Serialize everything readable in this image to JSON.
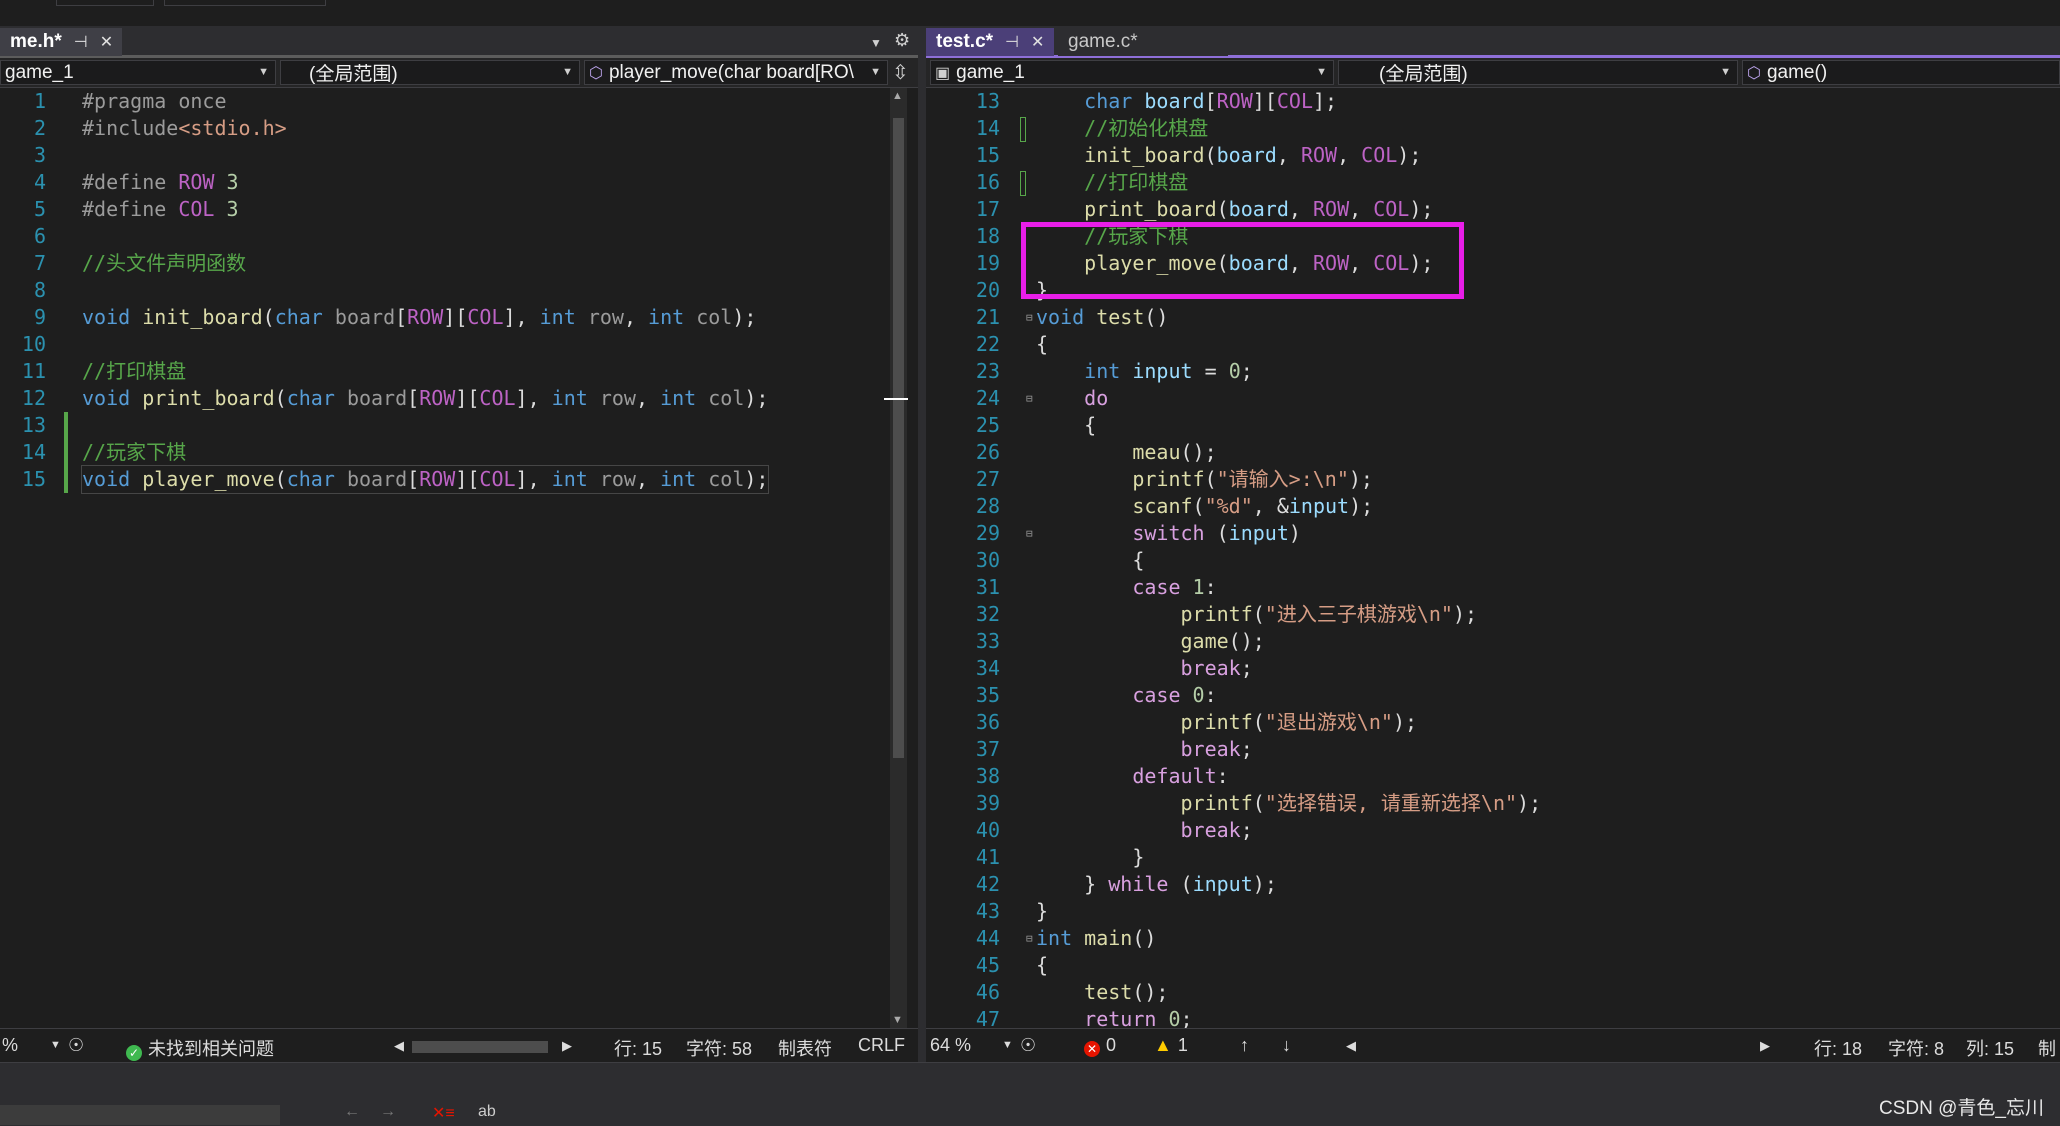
{
  "colors": {
    "highlight_box": "#e81ee8",
    "accent_tab": "#8e6fd8"
  },
  "left": {
    "tab_title": "me.h*",
    "tab_pin": "⊣",
    "tab_close": "✕",
    "nav": {
      "project": "game_1",
      "scope": "(全局范围)",
      "member": "player_move(char board[RO\\"
    },
    "status": {
      "zoom": "%",
      "issues": "未找到相关问题",
      "line": "行: 15",
      "char": "字符: 58",
      "tabs": "制表符",
      "eol": "CRLF"
    }
  },
  "right": {
    "tabs": [
      {
        "label": "test.c*",
        "pin": "⊣",
        "close": "✕"
      },
      {
        "label": "game.c*"
      }
    ],
    "nav": {
      "project": "game_1",
      "scope": "(全局范围)",
      "member": "game()"
    },
    "status": {
      "zoom": "64 %",
      "errors": "0",
      "warnings": "1",
      "line": "行: 18",
      "char": "字符: 8",
      "col": "列: 15",
      "tabs": "制"
    }
  },
  "left_code": [
    {
      "n": "1",
      "t": [
        [
          "pp",
          "#pragma once"
        ]
      ]
    },
    {
      "n": "2",
      "t": [
        [
          "pp",
          "#include"
        ],
        [
          "str",
          "<stdio.h>"
        ]
      ]
    },
    {
      "n": "3",
      "t": []
    },
    {
      "n": "4",
      "t": [
        [
          "pp",
          "#define "
        ],
        [
          "mac",
          "ROW"
        ],
        [
          "num",
          " 3"
        ]
      ]
    },
    {
      "n": "5",
      "t": [
        [
          "pp",
          "#define "
        ],
        [
          "mac",
          "COL"
        ],
        [
          "num",
          " 3"
        ]
      ]
    },
    {
      "n": "6",
      "t": []
    },
    {
      "n": "7",
      "t": [
        [
          "cm",
          "//头文件声明函数"
        ]
      ]
    },
    {
      "n": "8",
      "t": []
    },
    {
      "n": "9",
      "t": [
        [
          "kw",
          "void "
        ],
        [
          "fn",
          "init_board"
        ],
        [
          "",
          "("
        ],
        [
          "kw",
          "char "
        ],
        [
          "pp",
          "board"
        ],
        [
          "",
          "["
        ],
        [
          "mac",
          "ROW"
        ],
        [
          "",
          "]["
        ],
        [
          "mac",
          "COL"
        ],
        [
          "",
          "], "
        ],
        [
          "kw",
          "int "
        ],
        [
          "pp",
          "row"
        ],
        [
          "",
          ", "
        ],
        [
          "kw",
          "int "
        ],
        [
          "pp",
          "col"
        ],
        [
          "",
          ");"
        ]
      ]
    },
    {
      "n": "10",
      "t": []
    },
    {
      "n": "11",
      "t": [
        [
          "cm",
          "//打印棋盘"
        ]
      ]
    },
    {
      "n": "12",
      "t": [
        [
          "kw",
          "void "
        ],
        [
          "fn",
          "print_board"
        ],
        [
          "",
          "("
        ],
        [
          "kw",
          "char "
        ],
        [
          "pp",
          "board"
        ],
        [
          "",
          "["
        ],
        [
          "mac",
          "ROW"
        ],
        [
          "",
          "]["
        ],
        [
          "mac",
          "COL"
        ],
        [
          "",
          "], "
        ],
        [
          "kw",
          "int "
        ],
        [
          "pp",
          "row"
        ],
        [
          "",
          ", "
        ],
        [
          "kw",
          "int "
        ],
        [
          "pp",
          "col"
        ],
        [
          "",
          ");"
        ]
      ]
    },
    {
      "n": "13",
      "t": []
    },
    {
      "n": "14",
      "t": [
        [
          "cm",
          "//玩家下棋"
        ]
      ]
    },
    {
      "n": "15",
      "t": [
        [
          "kw",
          "void "
        ],
        [
          "fn",
          "player_move"
        ],
        [
          "",
          "("
        ],
        [
          "kw",
          "char "
        ],
        [
          "pp",
          "board"
        ],
        [
          "",
          "["
        ],
        [
          "mac",
          "ROW"
        ],
        [
          "",
          "]["
        ],
        [
          "mac",
          "COL"
        ],
        [
          "",
          "], "
        ],
        [
          "kw",
          "int "
        ],
        [
          "pp",
          "row"
        ],
        [
          "",
          ", "
        ],
        [
          "kw",
          "int "
        ],
        [
          "pp",
          "col"
        ],
        [
          "",
          ");"
        ]
      ]
    }
  ],
  "right_code": [
    {
      "n": "13",
      "t": [
        [
          "",
          "    "
        ],
        [
          "kw",
          "char "
        ],
        [
          "var",
          "board"
        ],
        [
          "",
          "["
        ],
        [
          "mac",
          "ROW"
        ],
        [
          "",
          "]["
        ],
        [
          "mac",
          "COL"
        ],
        [
          "",
          "];"
        ]
      ]
    },
    {
      "n": "14",
      "t": [
        [
          "",
          "    "
        ],
        [
          "cm",
          "//初始化棋盘"
        ]
      ]
    },
    {
      "n": "15",
      "t": [
        [
          "",
          "    "
        ],
        [
          "fn",
          "init_board"
        ],
        [
          "",
          "("
        ],
        [
          "var",
          "board"
        ],
        [
          "",
          ", "
        ],
        [
          "mac",
          "ROW"
        ],
        [
          "",
          ", "
        ],
        [
          "mac",
          "COL"
        ],
        [
          "",
          ");"
        ]
      ]
    },
    {
      "n": "16",
      "t": [
        [
          "",
          "    "
        ],
        [
          "cm",
          "//打印棋盘"
        ]
      ]
    },
    {
      "n": "17",
      "t": [
        [
          "",
          "    "
        ],
        [
          "fn",
          "print_board"
        ],
        [
          "",
          "("
        ],
        [
          "var",
          "board"
        ],
        [
          "",
          ", "
        ],
        [
          "mac",
          "ROW"
        ],
        [
          "",
          ", "
        ],
        [
          "mac",
          "COL"
        ],
        [
          "",
          ");"
        ]
      ]
    },
    {
      "n": "18",
      "t": [
        [
          "",
          "    "
        ],
        [
          "cm",
          "//玩家下棋"
        ]
      ]
    },
    {
      "n": "19",
      "t": [
        [
          "",
          "    "
        ],
        [
          "fn",
          "player_move"
        ],
        [
          "",
          "("
        ],
        [
          "var",
          "board"
        ],
        [
          "",
          ", "
        ],
        [
          "mac",
          "ROW"
        ],
        [
          "",
          ", "
        ],
        [
          "mac",
          "COL"
        ],
        [
          "",
          ");"
        ]
      ]
    },
    {
      "n": "20",
      "t": [
        [
          "",
          "}"
        ]
      ]
    },
    {
      "n": "21",
      "t": [
        [
          "kw",
          "void "
        ],
        [
          "fn",
          "test"
        ],
        [
          "",
          "()"
        ]
      ]
    },
    {
      "n": "22",
      "t": [
        [
          "",
          "{"
        ]
      ]
    },
    {
      "n": "23",
      "t": [
        [
          "",
          "    "
        ],
        [
          "kw",
          "int "
        ],
        [
          "var",
          "input"
        ],
        [
          "",
          " = "
        ],
        [
          "num",
          "0"
        ],
        [
          "",
          ";"
        ]
      ]
    },
    {
      "n": "24",
      "t": [
        [
          "",
          "    "
        ],
        [
          "kw2",
          "do"
        ]
      ]
    },
    {
      "n": "25",
      "t": [
        [
          "",
          "    {"
        ]
      ]
    },
    {
      "n": "26",
      "t": [
        [
          "",
          "        "
        ],
        [
          "fn",
          "meau"
        ],
        [
          "",
          "();"
        ]
      ]
    },
    {
      "n": "27",
      "t": [
        [
          "",
          "        "
        ],
        [
          "fn",
          "printf"
        ],
        [
          "",
          "("
        ],
        [
          "str",
          "\"请输入>:\\n\""
        ],
        [
          "",
          ");"
        ]
      ]
    },
    {
      "n": "28",
      "t": [
        [
          "",
          "        "
        ],
        [
          "fn",
          "scanf"
        ],
        [
          "",
          "("
        ],
        [
          "str",
          "\"%d\""
        ],
        [
          "",
          ", &"
        ],
        [
          "var",
          "input"
        ],
        [
          "",
          ");"
        ]
      ]
    },
    {
      "n": "29",
      "t": [
        [
          "",
          "        "
        ],
        [
          "kw2",
          "switch"
        ],
        [
          "",
          " ("
        ],
        [
          "var",
          "input"
        ],
        [
          "",
          ")"
        ]
      ]
    },
    {
      "n": "30",
      "t": [
        [
          "",
          "        {"
        ]
      ]
    },
    {
      "n": "31",
      "t": [
        [
          "",
          "        "
        ],
        [
          "kw2",
          "case "
        ],
        [
          "num",
          "1"
        ],
        [
          "",
          ":"
        ]
      ]
    },
    {
      "n": "32",
      "t": [
        [
          "",
          "            "
        ],
        [
          "fn",
          "printf"
        ],
        [
          "",
          "("
        ],
        [
          "str",
          "\"进入三子棋游戏\\n\""
        ],
        [
          "",
          ");"
        ]
      ]
    },
    {
      "n": "33",
      "t": [
        [
          "",
          "            "
        ],
        [
          "fn",
          "game"
        ],
        [
          "",
          "();"
        ]
      ]
    },
    {
      "n": "34",
      "t": [
        [
          "",
          "            "
        ],
        [
          "kw2",
          "break"
        ],
        [
          "",
          ";"
        ]
      ]
    },
    {
      "n": "35",
      "t": [
        [
          "",
          "        "
        ],
        [
          "kw2",
          "case "
        ],
        [
          "num",
          "0"
        ],
        [
          "",
          ":"
        ]
      ]
    },
    {
      "n": "36",
      "t": [
        [
          "",
          "            "
        ],
        [
          "fn",
          "printf"
        ],
        [
          "",
          "("
        ],
        [
          "str",
          "\"退出游戏\\n\""
        ],
        [
          "",
          ");"
        ]
      ]
    },
    {
      "n": "37",
      "t": [
        [
          "",
          "            "
        ],
        [
          "kw2",
          "break"
        ],
        [
          "",
          ";"
        ]
      ]
    },
    {
      "n": "38",
      "t": [
        [
          "",
          "        "
        ],
        [
          "kw2",
          "default"
        ],
        [
          "",
          ":"
        ]
      ]
    },
    {
      "n": "39",
      "t": [
        [
          "",
          "            "
        ],
        [
          "fn",
          "printf"
        ],
        [
          "",
          "("
        ],
        [
          "str",
          "\"选择错误, 请重新选择\\n\""
        ],
        [
          "",
          ");"
        ]
      ]
    },
    {
      "n": "40",
      "t": [
        [
          "",
          "            "
        ],
        [
          "kw2",
          "break"
        ],
        [
          "",
          ";"
        ]
      ]
    },
    {
      "n": "41",
      "t": [
        [
          "",
          "        }"
        ]
      ]
    },
    {
      "n": "42",
      "t": [
        [
          "",
          "    } "
        ],
        [
          "kw2",
          "while"
        ],
        [
          "",
          " ("
        ],
        [
          "var",
          "input"
        ],
        [
          "",
          ");"
        ]
      ]
    },
    {
      "n": "43",
      "t": [
        [
          "",
          "}"
        ]
      ]
    },
    {
      "n": "44",
      "t": [
        [
          "kw",
          "int "
        ],
        [
          "fn",
          "main"
        ],
        [
          "",
          "()"
        ]
      ]
    },
    {
      "n": "45",
      "t": [
        [
          "",
          "{"
        ]
      ]
    },
    {
      "n": "46",
      "t": [
        [
          "",
          "    "
        ],
        [
          "fn",
          "test"
        ],
        [
          "",
          "();"
        ]
      ]
    },
    {
      "n": "47",
      "t": [
        [
          "",
          "    "
        ],
        [
          "kw2",
          "return "
        ],
        [
          "num",
          "0"
        ],
        [
          "",
          ";"
        ]
      ]
    }
  ],
  "watermark": "CSDN @青色_忘川"
}
